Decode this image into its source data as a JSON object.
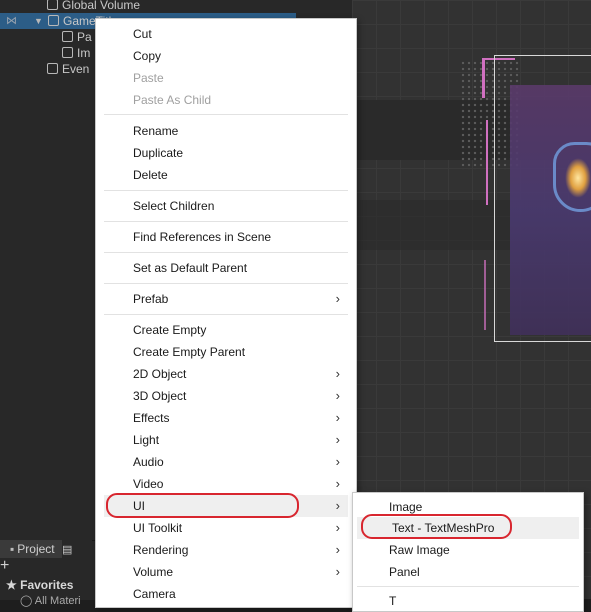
{
  "hierarchy": {
    "items": [
      {
        "label": "Global Volume"
      },
      {
        "label": "GameTitle"
      },
      {
        "label": "Pa"
      },
      {
        "label": "Im"
      },
      {
        "label": "Even"
      }
    ]
  },
  "context_menu": {
    "cut": "Cut",
    "copy": "Copy",
    "paste": "Paste",
    "paste_as_child": "Paste As Child",
    "rename": "Rename",
    "duplicate": "Duplicate",
    "delete": "Delete",
    "select_children": "Select Children",
    "find_references": "Find References in Scene",
    "set_default_parent": "Set as Default Parent",
    "prefab": "Prefab",
    "create_empty": "Create Empty",
    "create_empty_parent": "Create Empty Parent",
    "object_2d": "2D Object",
    "object_3d": "3D Object",
    "effects": "Effects",
    "light": "Light",
    "audio": "Audio",
    "video": "Video",
    "ui": "UI",
    "ui_toolkit": "UI Toolkit",
    "rendering": "Rendering",
    "volume": "Volume",
    "camera": "Camera"
  },
  "ui_submenu": {
    "image": "Image",
    "text_tmp": "Text - TextMeshPro",
    "raw_image": "Raw Image",
    "panel": "Panel",
    "toggle_partial": "T"
  },
  "project_panel": {
    "tab_project": "Project",
    "favorites": "Favorites",
    "all_materials_partial": "All Materi"
  },
  "colors": {
    "highlight_ring": "#d8262f",
    "selection_blue": "#2c5d87"
  }
}
